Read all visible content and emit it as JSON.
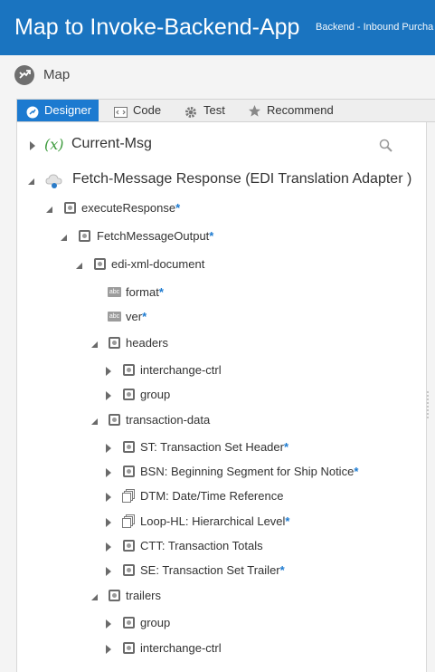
{
  "header": {
    "title": "Map to Invoke-Backend-App",
    "subtitle": "Backend - Inbound Purcha"
  },
  "mapbar": {
    "label": "Map"
  },
  "tabs": [
    {
      "label": "Designer",
      "icon": "designer-icon",
      "active": true
    },
    {
      "label": "Code",
      "icon": "code-icon",
      "active": false
    },
    {
      "label": "Test",
      "icon": "gear-icon",
      "active": false
    },
    {
      "label": "Recommend",
      "icon": "star-icon",
      "active": false
    }
  ],
  "tree": {
    "current_msg": {
      "prefix": "(x)",
      "label": "Current-Msg"
    },
    "fetch": {
      "label": "Fetch-Message Response (EDI Translation Adapter )"
    },
    "nodes": [
      {
        "label": "executeResponse",
        "required": "*"
      },
      {
        "label": "FetchMessageOutput",
        "required": "*"
      },
      {
        "label": "edi-xml-document",
        "required": ""
      },
      {
        "label": "format",
        "required": "*",
        "badge": "abc"
      },
      {
        "label": "ver",
        "required": "*",
        "badge": "abc"
      },
      {
        "label": "headers",
        "required": ""
      },
      {
        "label": "interchange-ctrl",
        "required": ""
      },
      {
        "label": "group",
        "required": ""
      },
      {
        "label": "transaction-data",
        "required": ""
      },
      {
        "label": "ST: Transaction Set Header",
        "required": "*"
      },
      {
        "label": "BSN: Beginning Segment for Ship Notice",
        "required": "*"
      },
      {
        "label": "DTM: Date/Time Reference",
        "required": ""
      },
      {
        "label": "Loop-HL: Hierarchical Level",
        "required": "*"
      },
      {
        "label": "CTT: Transaction Totals",
        "required": ""
      },
      {
        "label": "SE: Transaction Set Trailer",
        "required": "*"
      },
      {
        "label": "trailers",
        "required": ""
      },
      {
        "label": "group",
        "required": ""
      },
      {
        "label": "interchange-ctrl",
        "required": ""
      }
    ]
  },
  "colors": {
    "brand": "#1a74c0",
    "tab_active": "#1c7ad0",
    "required_star": "#1c7ad0",
    "variable_green": "#3c9a3c"
  }
}
